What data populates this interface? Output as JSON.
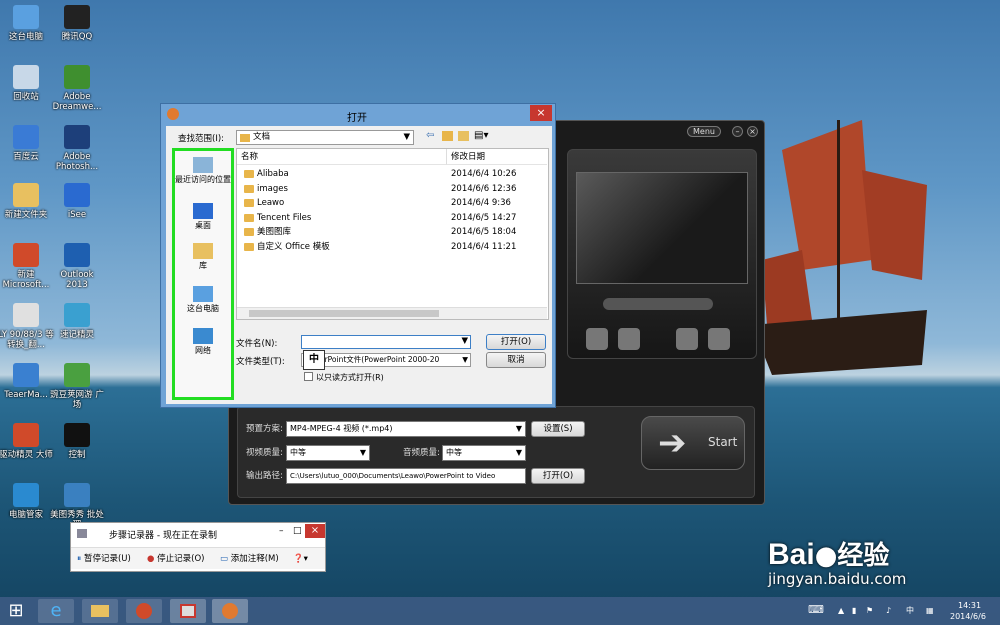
{
  "desktop_icons": [
    {
      "label": "这台电脑",
      "color": "#5aa0e0"
    },
    {
      "label": "腾讯QQ",
      "color": "#222222"
    },
    {
      "label": "回收站",
      "color": "#c8d8e8"
    },
    {
      "label": "Adobe Dreamwe...",
      "color": "#3f8f2f"
    },
    {
      "label": "百度云",
      "color": "#3a7bd5"
    },
    {
      "label": "Adobe Photosh...",
      "color": "#1d3f7a"
    },
    {
      "label": "新建文件夹",
      "color": "#e8c060"
    },
    {
      "label": "iSee",
      "color": "#2a6ad0"
    },
    {
      "label": "新建 Microsoft...",
      "color": "#d04a2a"
    },
    {
      "label": "Outlook 2013",
      "color": "#1e5fb0"
    },
    {
      "label": "LY 90/88/3 等转换_翻...",
      "color": "#e0e0e0"
    },
    {
      "label": "速记精灵",
      "color": "#3aa0d0"
    },
    {
      "label": "TeaerMa...",
      "color": "#3a80d0"
    },
    {
      "label": "豌豆荚网游 广场",
      "color": "#4aa040"
    },
    {
      "label": "驱动精灵 大师",
      "color": "#d04a2a"
    },
    {
      "label": "控制",
      "color": "#111111"
    },
    {
      "label": "电脑管家",
      "color": "#2a8ad0"
    },
    {
      "label": "美图秀秀 批处理",
      "color": "#3a80c0"
    }
  ],
  "app": {
    "menu_label": "Menu",
    "preset_label": "预置方案:",
    "preset_value": "MP4-MPEG-4 视频 (*.mp4)",
    "settings_button": "设置(S)",
    "video_quality_label": "视频质量:",
    "video_quality_value": "中等",
    "audio_quality_label": "音频质量:",
    "audio_quality_value": "中等",
    "output_path_label": "输出路径:",
    "output_path_value": "C:\\Users\\lutuo_000\\Documents\\Leawo\\PowerPoint to Video",
    "open_button": "打开(O)",
    "start_label": "Start"
  },
  "dialog": {
    "title": "打开",
    "lookin_label": "查找范围(I):",
    "lookin_value": "文档",
    "col_name": "名称",
    "col_date": "修改日期",
    "files": [
      {
        "name": "Alibaba",
        "date": "2014/6/4 10:26"
      },
      {
        "name": "images",
        "date": "2014/6/6 12:36"
      },
      {
        "name": "Leawo",
        "date": "2014/6/4 9:36"
      },
      {
        "name": "Tencent Files",
        "date": "2014/6/5 14:27"
      },
      {
        "name": "美图图库",
        "date": "2014/6/5 18:04"
      },
      {
        "name": "自定义 Office 模板",
        "date": "2014/6/4 11:21"
      }
    ],
    "places": [
      "最近访问的位置",
      "桌面",
      "库",
      "这台电脑",
      "网络"
    ],
    "filename_label": "文件名(N):",
    "filename_value": "",
    "filetype_label": "文件类型(T):",
    "filetype_value": "PowerPoint文件(PowerPoint 2000-20",
    "readonly_label": "以只读方式打开(R)",
    "open_button": "打开(O)",
    "cancel_button": "取消",
    "ime_char": "中"
  },
  "steps_recorder": {
    "title": "步骤记录器 - 现在正在录制",
    "pause": "暂停记录(U)",
    "stop": "停止记录(O)",
    "add_comment": "添加注释(M)"
  },
  "taskbar": {
    "time": "14:31",
    "date": "2014/6/6",
    "ime": "中"
  },
  "watermark": {
    "brand": "Bai",
    "brand2": "经验",
    "url": "jingyan.baidu.com"
  }
}
